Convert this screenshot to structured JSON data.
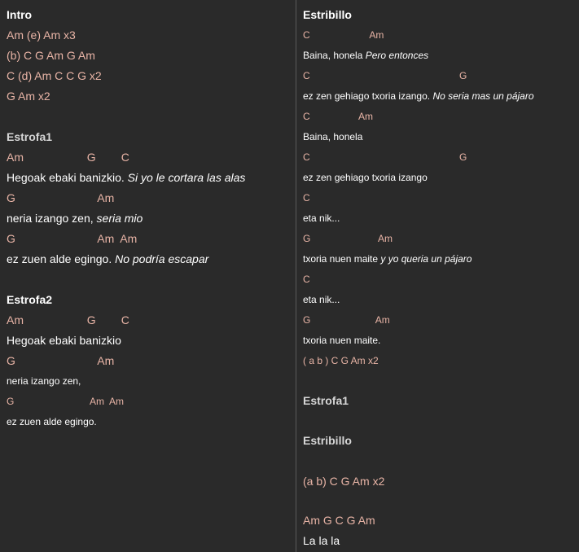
{
  "left": {
    "intro": {
      "heading": "Intro",
      "lines": [
        "Am (e) Am x3",
        "(b) C G Am G Am",
        "C (d) Am C C G x2",
        "G Am x2"
      ]
    },
    "estrofa1": {
      "heading": "Estrofa1",
      "c1": "Am                    G        C",
      "l1": "Hegoak ebaki banizkio. ",
      "t1": "Si yo le cortara las alas",
      "c2": "G                          Am",
      "l2": "neria izango zen, ",
      "t2": "seria mio",
      "c3": "G                          Am  Am",
      "l3": "ez zuen alde egingo. ",
      "t3": "No podría escapar"
    },
    "estrofa2": {
      "heading": "Estrofa2",
      "c1": "Am                    G        C",
      "l1": "Hegoak ebaki banizkio",
      "c2": "G                          Am",
      "l2": "neria izango zen,",
      "c3": "G                            Am  Am",
      "l3": "ez zuen alde egingo."
    }
  },
  "right": {
    "estribillo": {
      "heading": "Estribillo",
      "c1": "C                      Am",
      "l1": "Baina, honela ",
      "t1": "Pero entonces",
      "c2": "C                                                       G",
      "l2": "ez zen gehiago txoria izango. ",
      "t2": "No seria mas un pájaro",
      "c3": "C                  Am",
      "l3": "Baina, honela",
      "c4": "C                                                       G",
      "l4": "ez zen gehiago txoria izango",
      "c5": "C",
      "l5": "eta nik...",
      "c6": "G                         Am",
      "l6": "txoria nuen maite ",
      "t6": "y yo queria un pájaro",
      "c7": "C",
      "l7": "eta nik...",
      "c8": "G                        Am",
      "l8": "txoria nuen maite.",
      "c9": "( a b ) C G Am x2"
    },
    "estrofa1_ref": "Estrofa1",
    "estribillo_ref": "Estribillo",
    "outro1": "(a b) C G Am x2",
    "outro2": "Am G C G Am",
    "outro3": "La la la"
  }
}
